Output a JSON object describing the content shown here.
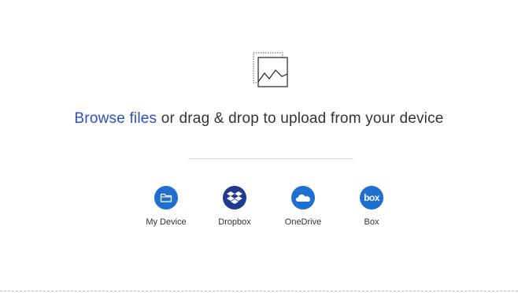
{
  "headline": {
    "browse_label": "Browse files",
    "rest_label": " or drag & drop to upload from your device"
  },
  "sources": [
    {
      "label": "My Device",
      "icon": "folder-icon",
      "color": "#1f6fd1"
    },
    {
      "label": "Dropbox",
      "icon": "dropbox-icon",
      "color": "#1f3a8f"
    },
    {
      "label": "OneDrive",
      "icon": "onedrive-icon",
      "color": "#1f6fd1"
    },
    {
      "label": "Box",
      "icon": "box-icon",
      "color": "#1f6fd1",
      "glyph": "box"
    }
  ],
  "colors": {
    "link": "#2a4fc4",
    "text": "#333333"
  }
}
